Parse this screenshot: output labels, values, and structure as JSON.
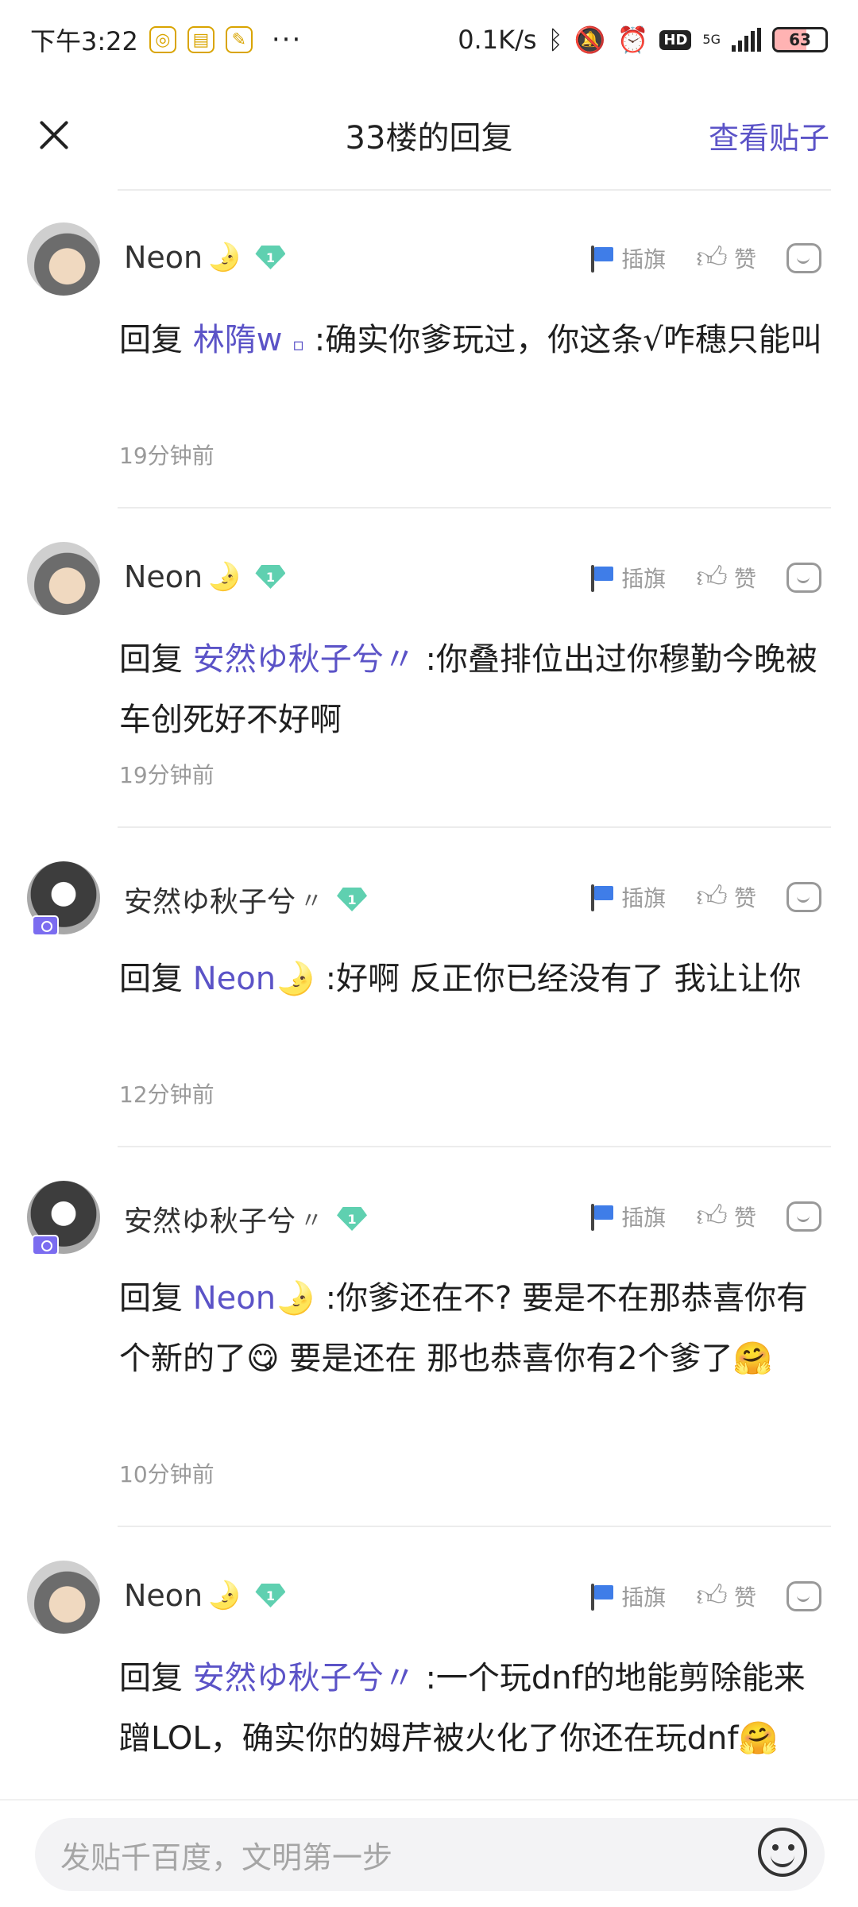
{
  "status_bar": {
    "time": "下午3:22",
    "dots": "···",
    "network_speed": "0.1K/s",
    "hd": "HD",
    "net_type": "5G",
    "battery": "63",
    "battery_level_percent": 63
  },
  "header": {
    "title": "33楼的回复",
    "view_post": "查看贴子"
  },
  "actions": {
    "flag": "插旗",
    "like": "赞"
  },
  "comments": [
    {
      "user": "Neon",
      "user_suffix": "🌛",
      "level": "1",
      "reply_prefix": "回复",
      "mention": "林隋w",
      "mention_suffix": "▫",
      "text": ":确实你爹玩过，你这条√咋穗只能叫",
      "time": "19分钟前"
    },
    {
      "user": "Neon",
      "user_suffix": "🌛",
      "level": "1",
      "reply_prefix": "回复",
      "mention": "安然ゆ秋子兮〃",
      "mention_suffix": "",
      "text": ":你叠排位出过你穆勤今晚被车创死好不好啊",
      "time": "19分钟前"
    },
    {
      "user": "安然ゆ秋子兮",
      "user_suffix": "〃",
      "level": "1",
      "reply_prefix": "回复",
      "mention": "Neon🌛",
      "mention_suffix": "",
      "text": ":好啊 反正你已经没有了 我让让你",
      "time": "12分钟前"
    },
    {
      "user": "安然ゆ秋子兮",
      "user_suffix": "〃",
      "level": "1",
      "reply_prefix": "回复",
      "mention": "Neon🌛",
      "mention_suffix": "",
      "text": ":你爹还在不? 要是不在那恭喜你有个新的了😋 要是还在 那也恭喜你有2个爹了🤗",
      "time": "10分钟前"
    },
    {
      "user": "Neon",
      "user_suffix": "🌛",
      "level": "1",
      "reply_prefix": "回复",
      "mention": "安然ゆ秋子兮〃",
      "mention_suffix": "",
      "text": ":一个玩dnf的地能剪除能来蹭LOL，确实你的姆芹被火化了你还在玩dnf🤗",
      "time": ""
    }
  ],
  "input": {
    "placeholder": "发贴千百度，文明第一步"
  }
}
